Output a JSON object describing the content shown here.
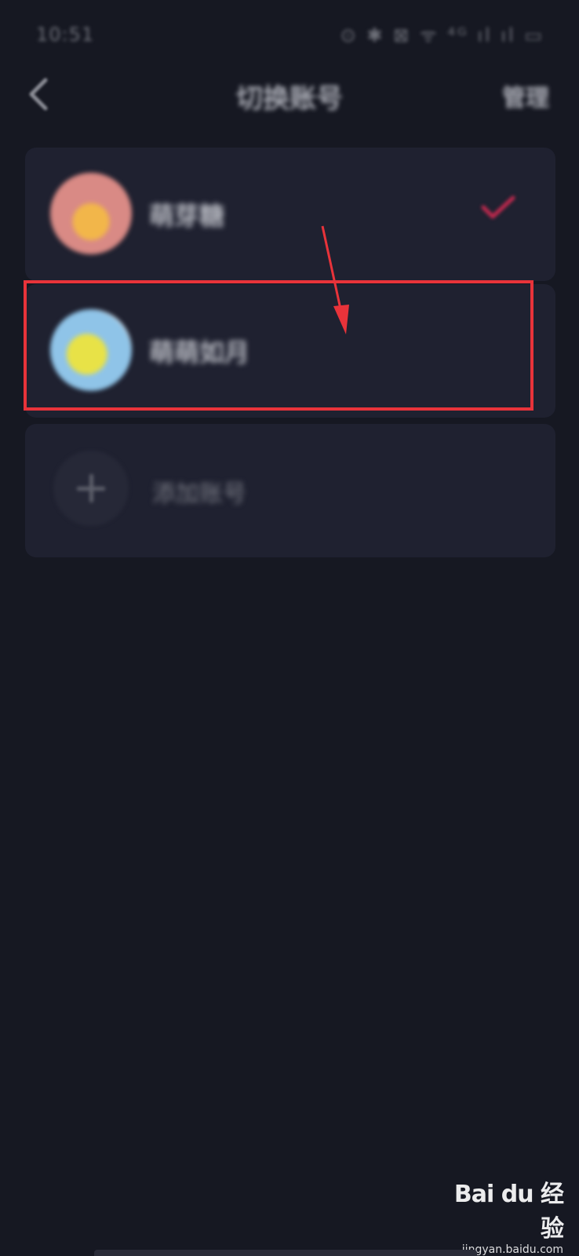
{
  "status_bar": {
    "time": "10:51",
    "icons": "⊙ ✱ ⊠ ᯤ ⁴ᴳ ıl ıl ▭"
  },
  "nav": {
    "back_icon": "chevron-left-icon",
    "title": "切换账号",
    "manage_label": "管理"
  },
  "accounts": [
    {
      "name": "萌芽糖",
      "avatar_icon": "avatar-icon",
      "selected": true,
      "check_color": "#e0345a"
    },
    {
      "name": "萌萌如月",
      "avatar_icon": "avatar-icon",
      "selected": false
    }
  ],
  "add_account": {
    "label": "添加账号",
    "icon": "plus-icon"
  },
  "annotation": {
    "highlight_color": "#e8333a"
  },
  "watermark": {
    "logo": "Bai du 经验",
    "url": "jingyan.baidu.com"
  }
}
